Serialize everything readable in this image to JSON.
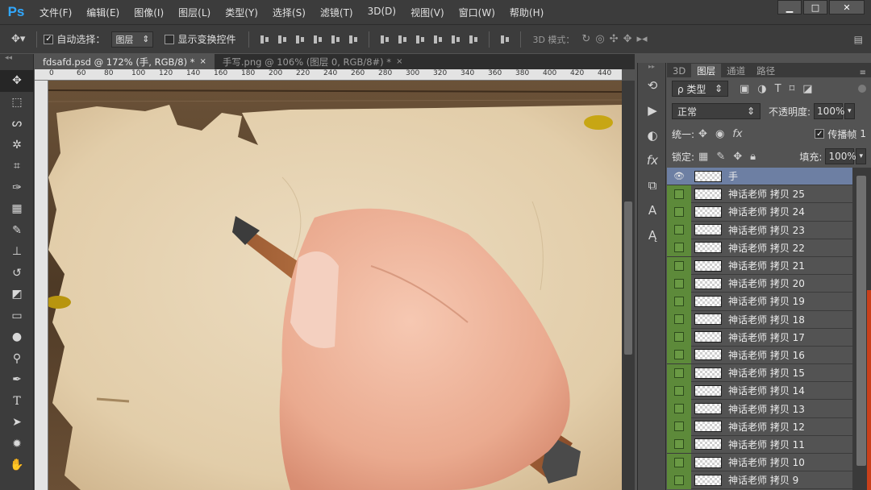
{
  "app": {
    "logo": "Ps",
    "menu": [
      "文件(F)",
      "编辑(E)",
      "图像(I)",
      "图层(L)",
      "类型(Y)",
      "选择(S)",
      "滤镜(T)",
      "3D(D)",
      "视图(V)",
      "窗口(W)",
      "帮助(H)"
    ],
    "window_controls": [
      "▁",
      "□",
      "✕"
    ]
  },
  "options": {
    "auto_select_label": "自动选择：",
    "auto_select_checked": true,
    "auto_select_value": "图层",
    "show_transform_label": "显示变换控件",
    "mode_3d_label": "3D 模式："
  },
  "documents": {
    "tabs": [
      {
        "label": "fdsafd.psd @ 172% (手, RGB/8) *",
        "close": "×",
        "active": true
      },
      {
        "label": "手写.png @ 106% (图层 0, RGB/8#) *",
        "close": "×",
        "active": false
      }
    ]
  },
  "ruler": {
    "ticks": [
      "0",
      "60",
      "80",
      "100",
      "120",
      "140",
      "160",
      "180",
      "200",
      "220",
      "240",
      "260",
      "280",
      "300",
      "320",
      "340",
      "360",
      "380",
      "400",
      "420",
      "440"
    ]
  },
  "layers_panel": {
    "tabs": [
      "3D",
      "图层",
      "通道",
      "路径"
    ],
    "active_tab": "图层",
    "filter_label": "ρ 类型",
    "blend_mode": "正常",
    "opacity_label": "不透明度:",
    "opacity_value": "100%",
    "unify_label": "统一:",
    "propagate_label": "传播帧",
    "propagate_value": "1",
    "lock_label": "锁定:",
    "fill_label": "填充:",
    "fill_value": "100%",
    "layers": [
      {
        "name": "手",
        "selected": true,
        "visible": true
      },
      {
        "name": "神话老师 拷贝 25",
        "selected": false
      },
      {
        "name": "神话老师 拷贝 24",
        "selected": false
      },
      {
        "name": "神话老师 拷贝 23",
        "selected": false
      },
      {
        "name": "神话老师 拷贝 22",
        "selected": false
      },
      {
        "name": "神话老师 拷贝 21",
        "selected": false
      },
      {
        "name": "神话老师 拷贝 20",
        "selected": false
      },
      {
        "name": "神话老师 拷贝 19",
        "selected": false
      },
      {
        "name": "神话老师 拷贝 18",
        "selected": false
      },
      {
        "name": "神话老师 拷贝 17",
        "selected": false
      },
      {
        "name": "神话老师 拷贝 16",
        "selected": false
      },
      {
        "name": "神话老师 拷贝 15",
        "selected": false
      },
      {
        "name": "神话老师 拷贝 14",
        "selected": false
      },
      {
        "name": "神话老师 拷贝 13",
        "selected": false
      },
      {
        "name": "神话老师 拷贝 12",
        "selected": false
      },
      {
        "name": "神话老师 拷贝 11",
        "selected": false
      },
      {
        "name": "神话老师 拷贝 10",
        "selected": false
      },
      {
        "name": "神话老师 拷贝 9",
        "selected": false
      }
    ]
  },
  "colors": {
    "accent": "#31a8ff",
    "layer_selected": "#6d7fa3",
    "visibility_green": "#5d8a3a"
  }
}
